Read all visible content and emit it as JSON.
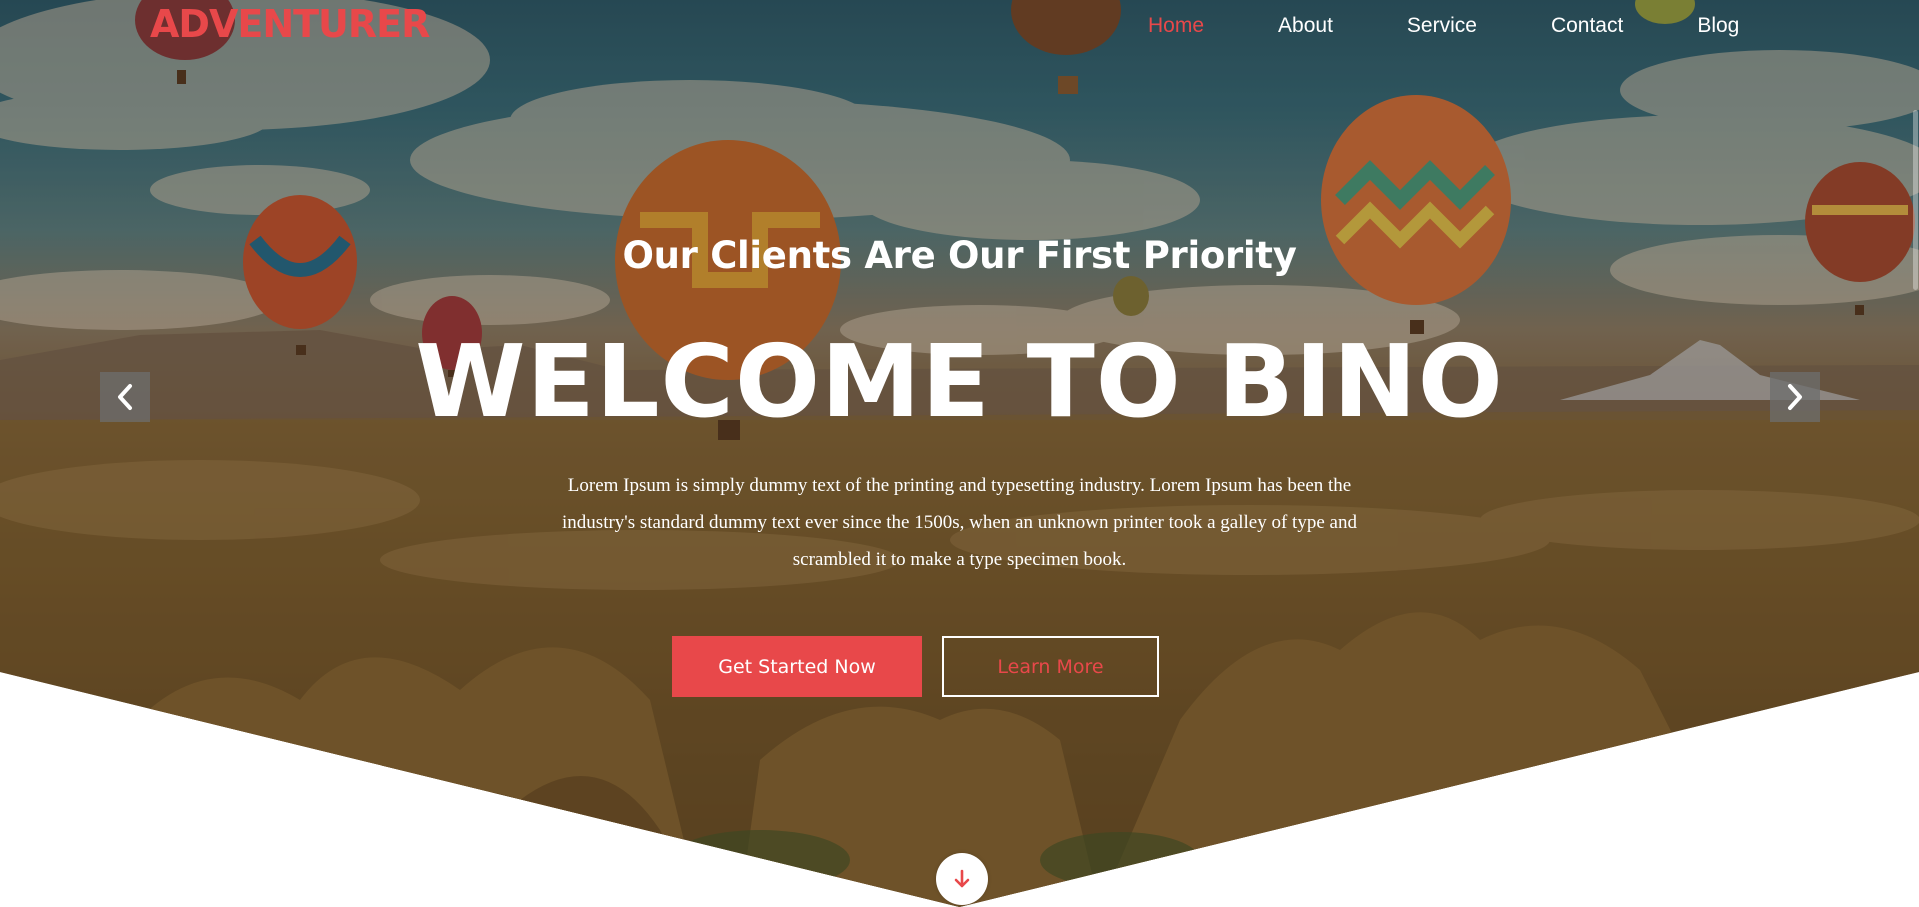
{
  "brand": {
    "logo_text": "ADVENTURER"
  },
  "nav": {
    "items": [
      {
        "label": "Home",
        "active": true
      },
      {
        "label": "About",
        "active": false
      },
      {
        "label": "Service",
        "active": false
      },
      {
        "label": "Contact",
        "active": false
      },
      {
        "label": "Blog",
        "active": false
      }
    ]
  },
  "hero": {
    "subtitle": "Our Clients Are Our First Priority",
    "headline": "WELCOME TO BINO",
    "description": "Lorem Ipsum is simply dummy text of the printing and typesetting industry. Lorem Ipsum has been the industry's standard dummy text ever since the 1500s, when an unknown printer took a galley of type and scrambled it to make a type specimen book.",
    "primary_button": "Get Started Now",
    "secondary_button": "Learn More"
  },
  "icons": {
    "prev": "chevron-left-icon",
    "next": "chevron-right-icon",
    "scroll": "arrow-down-icon"
  },
  "colors": {
    "accent": "#e8484a",
    "text_light": "#ffffff",
    "arrow_bg": "#6e6e6e"
  }
}
